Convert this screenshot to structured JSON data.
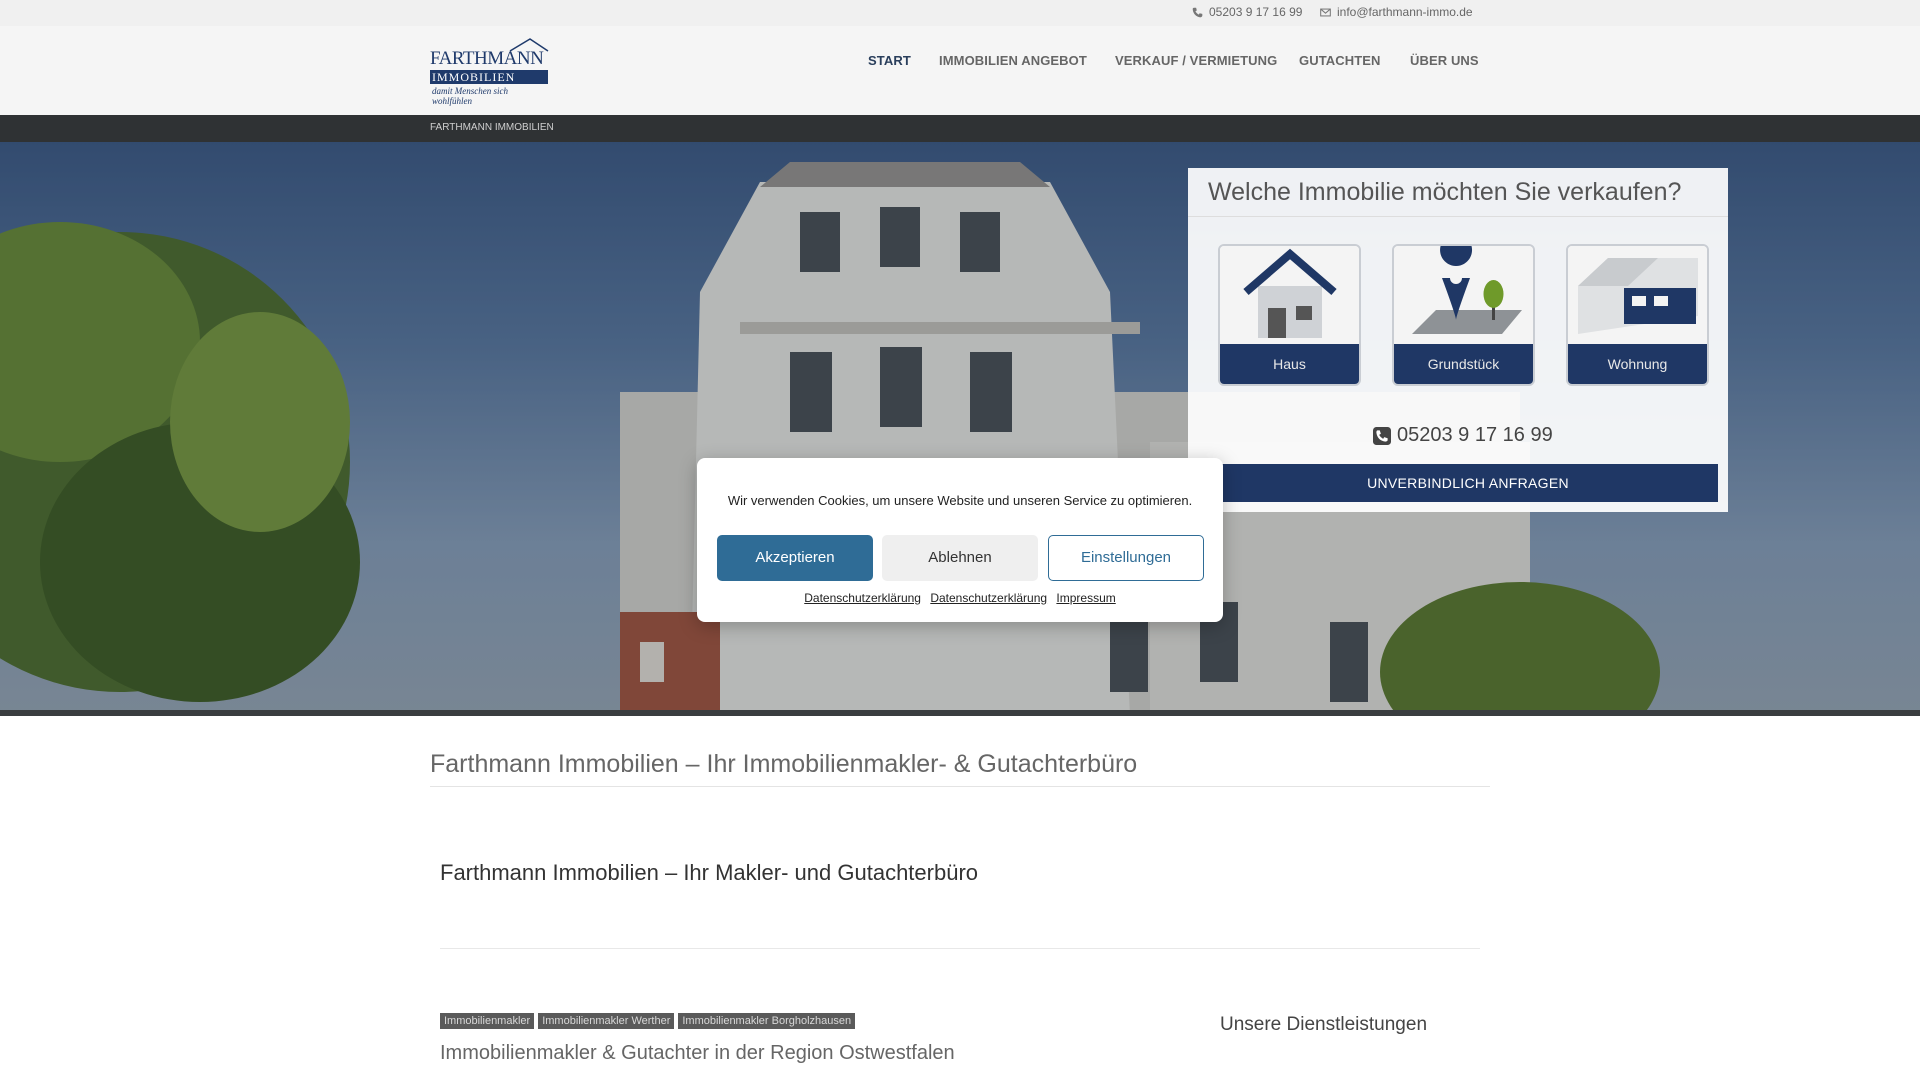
{
  "topbar": {
    "phone": "05203 9 17 16 99",
    "email": "info@farthmann-immo.de",
    "phone_icon": "phone-icon",
    "email_icon": "envelope-icon"
  },
  "logo": {
    "line1": "FARTHMANN",
    "line2": "IMMOBILIEN",
    "slogan": "damit Menschen sich wohlfühlen"
  },
  "nav": {
    "items": [
      {
        "label": "START",
        "active": true
      },
      {
        "label": "IMMOBILIEN ANGEBOT",
        "active": false
      },
      {
        "label": "VERKAUF / VERMIETUNG",
        "active": false
      },
      {
        "label": "GUTACHTEN",
        "active": false
      },
      {
        "label": "ÜBER UNS",
        "active": false
      }
    ]
  },
  "breadcrumb": "FARTHMANN IMMOBILIEN",
  "sell_panel": {
    "title": "Welche Immobilie möchten Sie verkaufen?",
    "cards": [
      {
        "label": "Haus",
        "icon": "house-icon"
      },
      {
        "label": "Grundstück",
        "icon": "map-pin-tree-icon"
      },
      {
        "label": "Wohnung",
        "icon": "apartment-icon"
      }
    ],
    "phone": "05203 9 17 16 99",
    "cta": "UNVERBINDLICH ANFRAGEN"
  },
  "cookie": {
    "message": "Wir verwenden Cookies, um unsere Website und unseren Service zu optimieren.",
    "accept": "Akzeptieren",
    "deny": "Ablehnen",
    "settings": "Einstellungen",
    "links": [
      "Datenschutzerklärung",
      "Datenschutzerklärung",
      "Impressum"
    ]
  },
  "content": {
    "h1": "Farthmann Immobilien – Ihr Immobilienmakler- & Gutachterbüro",
    "h2": "Farthmann Immobilien – Ihr Makler- und Gutachterbüro",
    "tags": [
      "Immobilienmakler",
      "Immobilienmakler Werther",
      "Immobilienmakler Borgholzhausen"
    ],
    "h3": "Immobilienmakler & Gutachter in der Region Ostwestfalen",
    "sidebar_heading": "Unsere Dienstleistungen"
  },
  "colors": {
    "brand_navy": "#1f3765",
    "accept_blue": "#2f6c96",
    "dark_strip": "#2f3234"
  }
}
